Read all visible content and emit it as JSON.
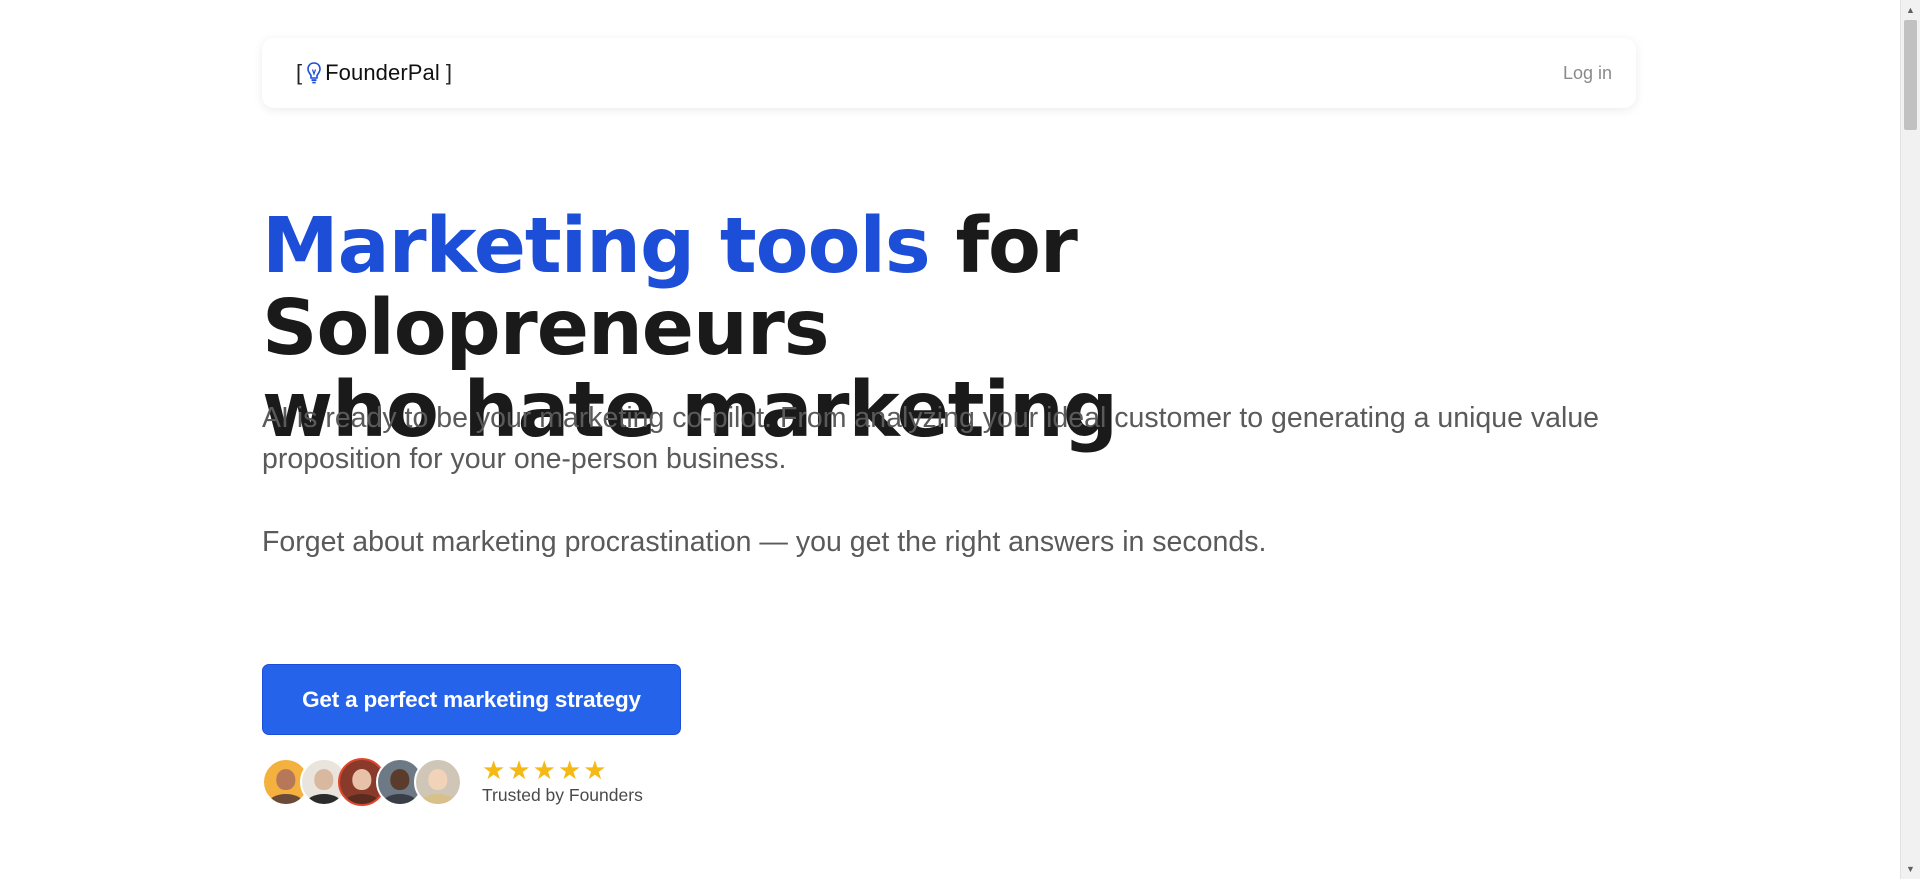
{
  "header": {
    "logo_open_bracket": "[",
    "logo_name": "FounderPal",
    "logo_close_bracket": "]",
    "login_label": "Log in"
  },
  "hero": {
    "title_accent": "Marketing tools",
    "title_rest_line1": " for Solopreneurs",
    "title_line2": "who hate marketing",
    "subtitle": "AI is ready to be your marketing co-pilot. From analyzing your ideal customer to generating a unique value proposition for your one-person business.",
    "subtitle2": "Forget about marketing procrastination — you get the right answers in seconds.",
    "cta_label": "Get a perfect marketing strategy"
  },
  "social_proof": {
    "stars": [
      "★",
      "★",
      "★",
      "★",
      "★"
    ],
    "rating_stars_filled": 5,
    "trusted_label": "Trusted by Founders",
    "avatars": [
      "founder-1",
      "founder-2",
      "founder-3",
      "founder-4",
      "founder-5"
    ]
  },
  "colors": {
    "accent": "#1d4ed8",
    "cta": "#2563eb",
    "star": "#f5b916",
    "heading": "#1a1a1a",
    "body_text": "#5a5a5a"
  },
  "scrollbar": {
    "up_arrow": "▲",
    "down_arrow": "▼"
  }
}
